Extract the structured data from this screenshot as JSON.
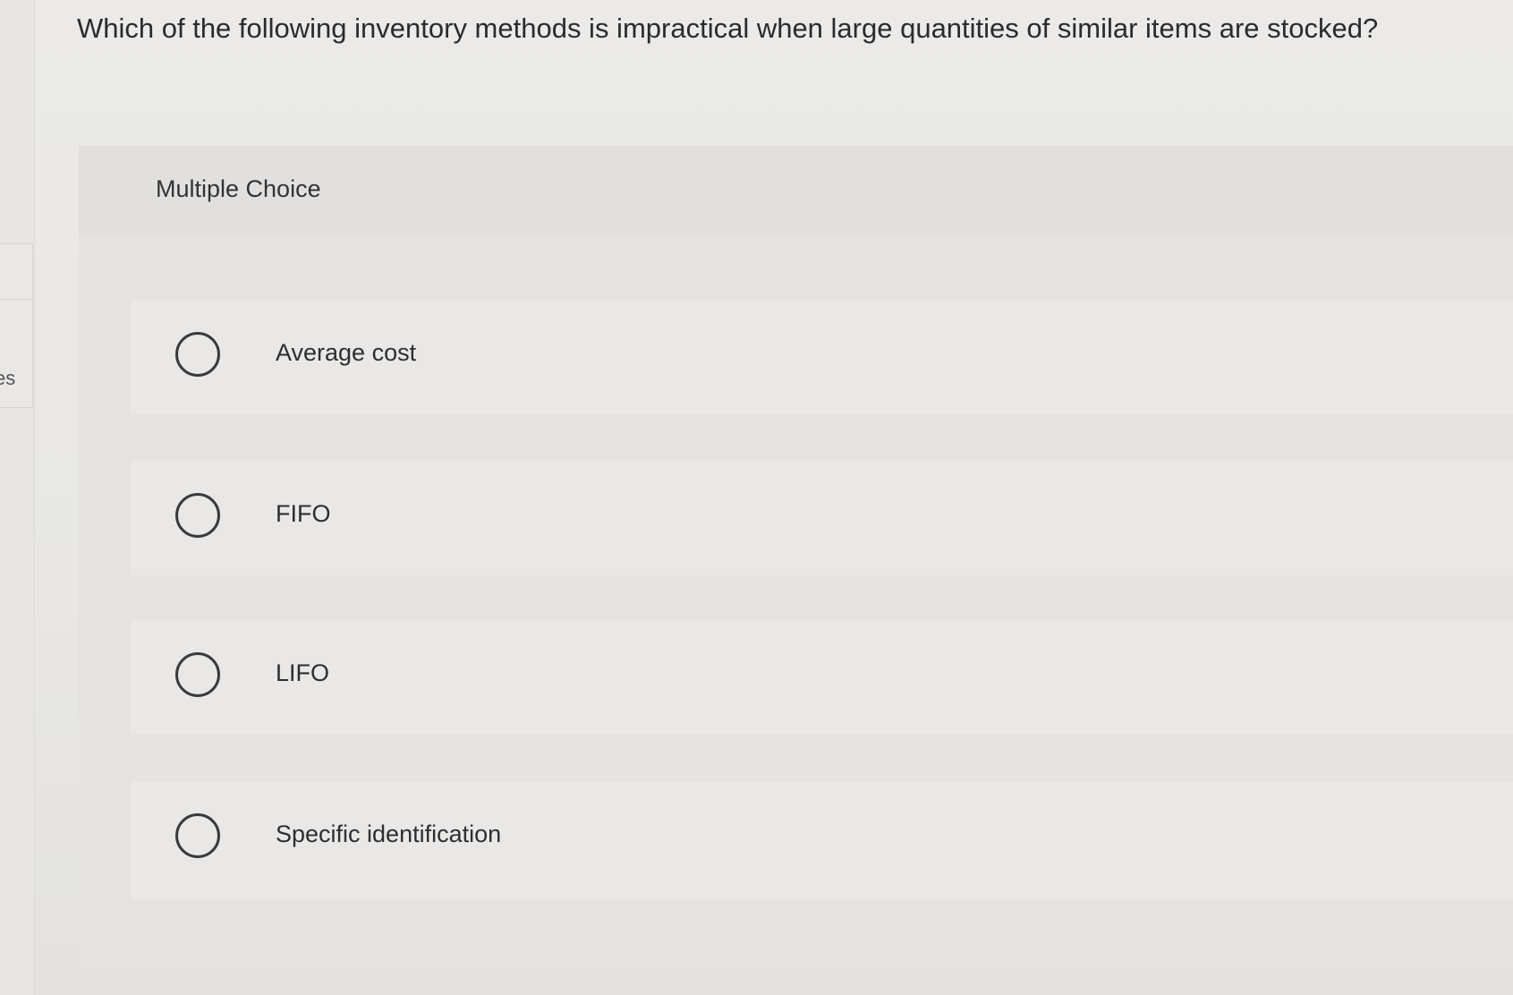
{
  "question": {
    "text": "Which of the following inventory methods is impractical when large quantities of similar items are stocked?"
  },
  "left_gutter": {
    "partial_text": "es"
  },
  "multiple_choice": {
    "title": "Multiple Choice",
    "options": [
      {
        "label": "Average cost",
        "selected": false,
        "icon": "radio-empty-icon"
      },
      {
        "label": "FIFO",
        "selected": false,
        "icon": "radio-empty-icon"
      },
      {
        "label": "LIFO",
        "selected": false,
        "icon": "radio-empty-icon"
      },
      {
        "label": "Specific identification",
        "selected": false,
        "icon": "radio-empty-icon"
      }
    ]
  },
  "colors": {
    "background": "#e9e8e6",
    "panel": "#e4e3e1",
    "text": "#2b2b2b",
    "radio_border": "#3a3a3a"
  }
}
